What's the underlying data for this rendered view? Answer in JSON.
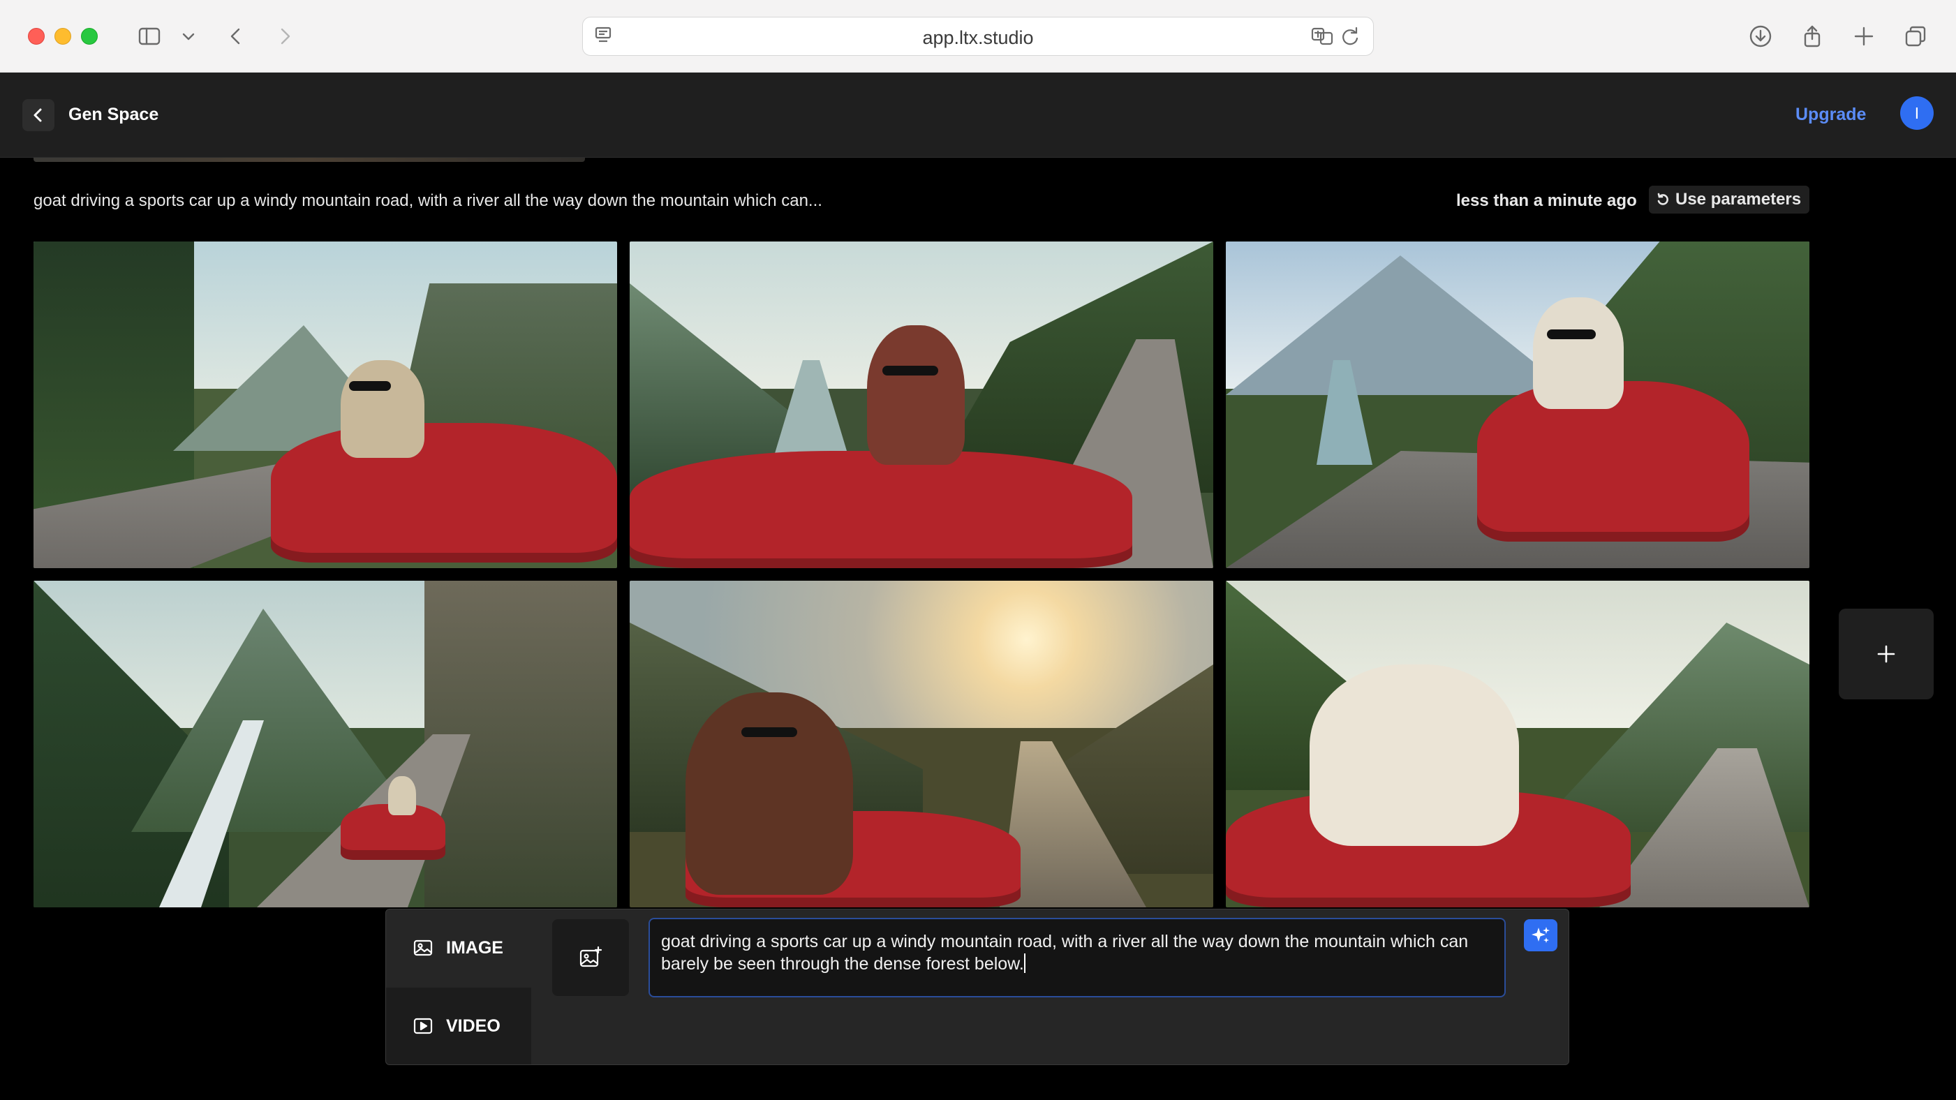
{
  "browser": {
    "url": "app.ltx.studio"
  },
  "header": {
    "title": "Gen Space",
    "upgrade_label": "Upgrade",
    "avatar_initial": "I"
  },
  "generation": {
    "prompt_preview": "goat driving a sports car up a windy mountain road, with a river all the way down the mountain which can...",
    "timestamp": "less than a minute ago",
    "use_parameters_label": "Use parameters",
    "images": [
      {
        "name": "goat-image-1"
      },
      {
        "name": "goat-image-2"
      },
      {
        "name": "goat-image-3"
      },
      {
        "name": "goat-image-4"
      },
      {
        "name": "goat-image-5"
      },
      {
        "name": "goat-image-6"
      }
    ]
  },
  "composer": {
    "modes": [
      {
        "label": "IMAGE",
        "icon": "image-icon"
      },
      {
        "label": "VIDEO",
        "icon": "video-icon"
      }
    ],
    "prompt_text": "goat driving a sports car up a windy mountain road, with a river all the way down the mountain which can barely be seen through the dense forest below.",
    "accent_color": "#2f6ef2"
  }
}
